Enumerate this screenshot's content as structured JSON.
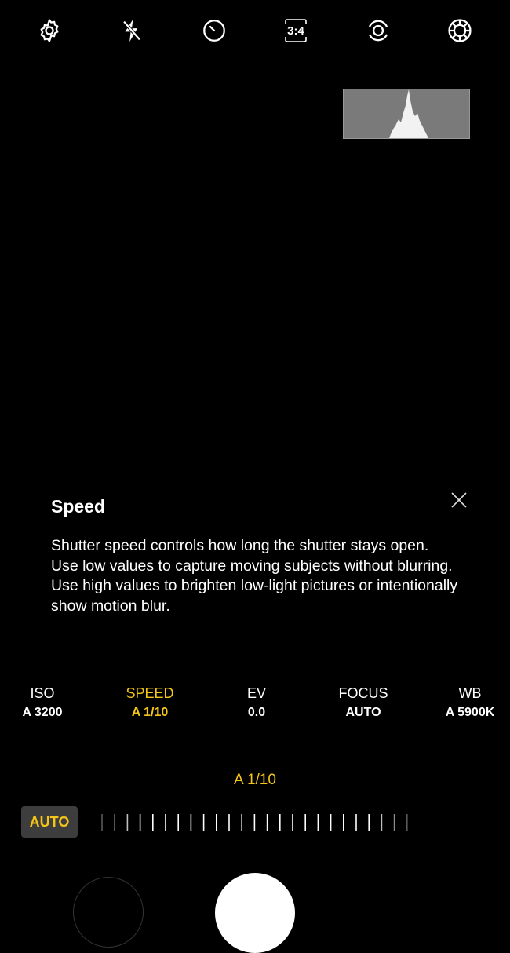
{
  "topbar": {
    "icons": [
      "gear-icon",
      "flash-off-icon",
      "timer-icon",
      "aspect-ratio-icon",
      "motion-photo-icon",
      "filter-icon"
    ],
    "ratio_label": "3:4"
  },
  "tooltip": {
    "title": "Speed",
    "body": "Shutter speed controls how long the shutter stays open. Use low values to capture moving subjects without blurring. Use high values to brighten low-light pictures or intentionally show motion blur."
  },
  "params": [
    {
      "label": "ISO",
      "value": "A 3200"
    },
    {
      "label": "SPEED",
      "value": "A 1/10"
    },
    {
      "label": "EV",
      "value": "0.0"
    },
    {
      "label": "FOCUS",
      "value": "AUTO"
    },
    {
      "label": "WB",
      "value": "A 5900K"
    }
  ],
  "current_value": "A 1/10",
  "auto_label": "AUTO",
  "colors": {
    "accent": "#f5c518",
    "background": "#000000",
    "histogram_bg": "#7a7a7a"
  }
}
